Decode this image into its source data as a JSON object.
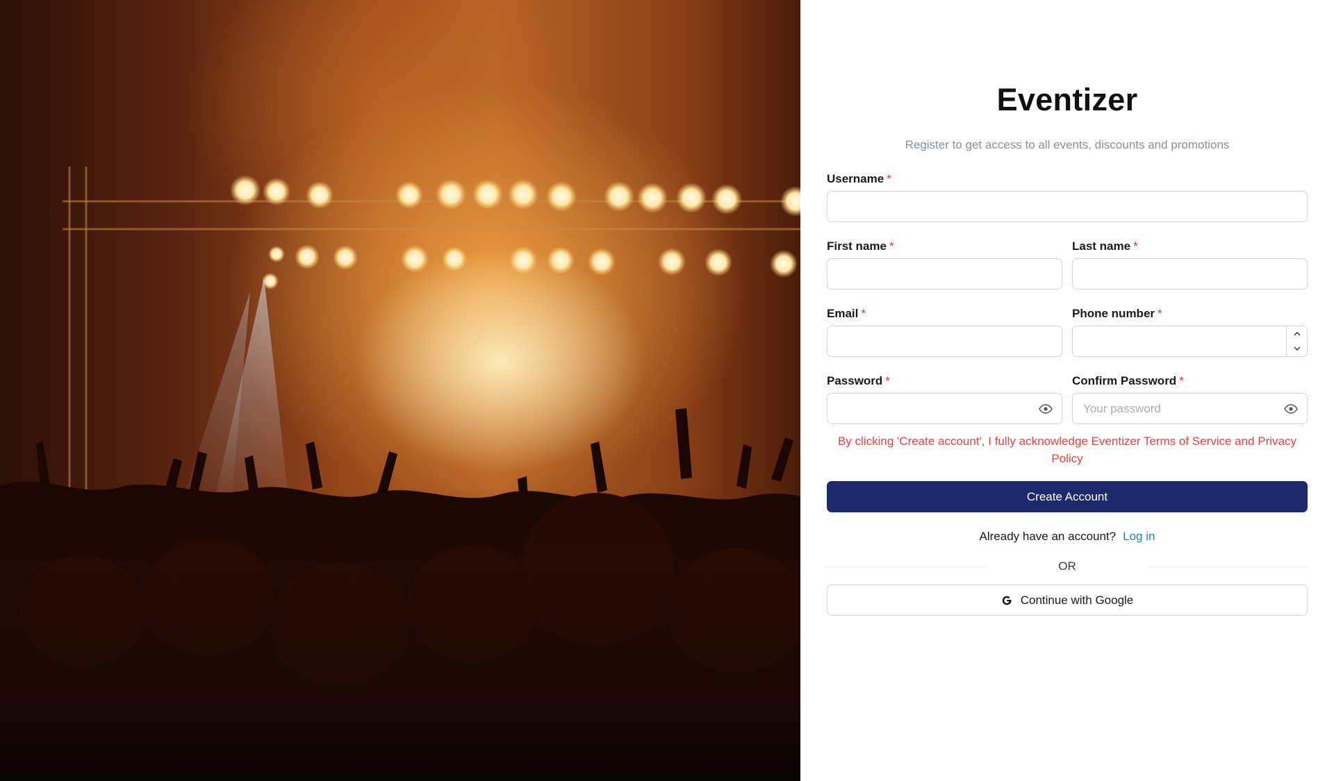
{
  "app": {
    "title": "Eventizer",
    "subtitle": "Register to get access to all events, discounts and promotions"
  },
  "form": {
    "required_mark": "*",
    "fields": {
      "username": {
        "label": "Username",
        "value": "",
        "placeholder": ""
      },
      "first_name": {
        "label": "First name",
        "value": "",
        "placeholder": ""
      },
      "last_name": {
        "label": "Last name",
        "value": "",
        "placeholder": ""
      },
      "email": {
        "label": "Email",
        "value": "",
        "placeholder": ""
      },
      "phone": {
        "label": "Phone number",
        "value": "",
        "placeholder": ""
      },
      "password": {
        "label": "Password",
        "value": "",
        "placeholder": ""
      },
      "confirm_password": {
        "label": "Confirm Password",
        "value": "",
        "placeholder": "Your password"
      }
    },
    "terms_text": "By clicking 'Create account', I fully acknowledge Eventizer Terms of Service and Privacy Policy",
    "submit_label": "Create Account",
    "login_prompt": "Already have an account?",
    "login_link": "Log in",
    "divider_label": "OR",
    "google_label": "Continue with Google"
  },
  "icons": {
    "eye": "eye-icon",
    "stepper_up": "chevron-up-icon",
    "stepper_down": "chevron-down-icon",
    "google": "google-icon"
  },
  "colors": {
    "primary": "#1c2a6d",
    "link": "#1c7ed6",
    "error": "#f03e3e",
    "required": "#e03131"
  }
}
